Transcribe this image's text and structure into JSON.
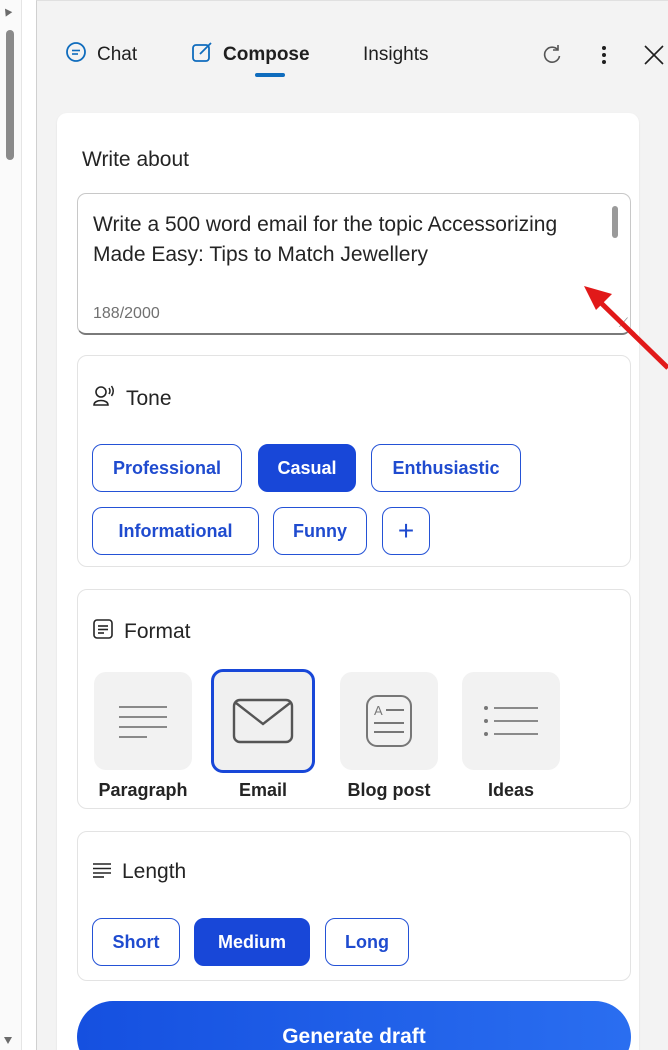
{
  "header": {
    "tabs": [
      {
        "label": "Chat",
        "icon": "chat-icon"
      },
      {
        "label": "Compose",
        "icon": "compose-icon",
        "active": true
      },
      {
        "label": "Insights"
      }
    ],
    "icons": [
      "refresh-icon",
      "more-icon",
      "close-icon"
    ]
  },
  "write_about": {
    "label": "Write about",
    "value": "Write a 500 word email for the topic Accessorizing Made Easy: Tips to Match Jewellery",
    "counter": "188/2000"
  },
  "tone": {
    "label": "Tone",
    "options": [
      "Professional",
      "Casual",
      "Enthusiastic",
      "Informational",
      "Funny"
    ],
    "selected": "Casual",
    "add_label": "+"
  },
  "format": {
    "label": "Format",
    "options": [
      "Paragraph",
      "Email",
      "Blog post",
      "Ideas"
    ],
    "selected": "Email"
  },
  "length": {
    "label": "Length",
    "options": [
      "Short",
      "Medium",
      "Long"
    ],
    "selected": "Medium"
  },
  "generate_button": "Generate draft",
  "colors": {
    "accent": "#1847d8",
    "panel_bg": "#f3f3f3",
    "annotation_arrow": "#e11919"
  }
}
